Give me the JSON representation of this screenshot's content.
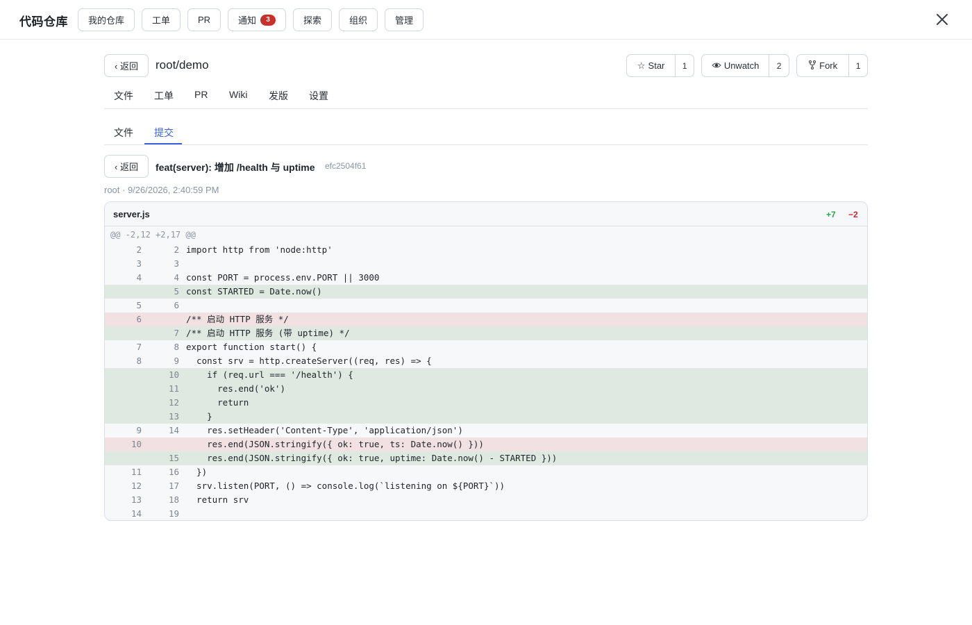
{
  "app": {
    "title": "代码仓库",
    "nav": [
      {
        "label": "我的仓库"
      },
      {
        "label": "工单"
      },
      {
        "label": "PR"
      },
      {
        "label": "通知",
        "badge": "3"
      },
      {
        "label": "探索"
      },
      {
        "label": "组织"
      },
      {
        "label": "管理"
      }
    ],
    "close_icon": "close-icon"
  },
  "repo": {
    "back_label": "‹ 返回",
    "name": "root/demo",
    "star": {
      "label": "Star",
      "icon": "star-icon",
      "count": "1"
    },
    "watch": {
      "label": "Unwatch",
      "icon": "eye-icon",
      "count": "2"
    },
    "fork": {
      "label": "Fork",
      "icon": "fork-icon",
      "count": "1"
    },
    "tabs": [
      "文件",
      "工单",
      "PR",
      "Wiki",
      "发版",
      "设置"
    ]
  },
  "subtabs": {
    "items": [
      "文件",
      "提交"
    ],
    "active": "提交"
  },
  "commit": {
    "back_label": "‹ 返回",
    "message": "feat(server): 增加 /health 与 uptime",
    "sha": "efc2504f61",
    "meta": "root · 9/26/2026, 2:40:59 PM"
  },
  "diff": {
    "file": "server.js",
    "additions": "+7",
    "deletions": "−2",
    "hunk": "@@ -2,12 +2,17 @@",
    "lines": [
      {
        "type": "ctx",
        "old": "2",
        "new": "2",
        "code": "import http from 'node:http'"
      },
      {
        "type": "ctx",
        "old": "3",
        "new": "3",
        "code": ""
      },
      {
        "type": "ctx",
        "old": "4",
        "new": "4",
        "code": "const PORT = process.env.PORT || 3000"
      },
      {
        "type": "add",
        "old": "",
        "new": "5",
        "code": "const STARTED = Date.now()"
      },
      {
        "type": "ctx",
        "old": "5",
        "new": "6",
        "code": ""
      },
      {
        "type": "del",
        "old": "6",
        "new": "",
        "code": "/** 启动 HTTP 服务 */"
      },
      {
        "type": "add",
        "old": "",
        "new": "7",
        "code": "/** 启动 HTTP 服务 (带 uptime) */"
      },
      {
        "type": "ctx",
        "old": "7",
        "new": "8",
        "code": "export function start() {"
      },
      {
        "type": "ctx",
        "old": "8",
        "new": "9",
        "code": "  const srv = http.createServer((req, res) => {"
      },
      {
        "type": "add",
        "old": "",
        "new": "10",
        "code": "    if (req.url === '/health') {"
      },
      {
        "type": "add",
        "old": "",
        "new": "11",
        "code": "      res.end('ok')"
      },
      {
        "type": "add",
        "old": "",
        "new": "12",
        "code": "      return"
      },
      {
        "type": "add",
        "old": "",
        "new": "13",
        "code": "    }"
      },
      {
        "type": "ctx",
        "old": "9",
        "new": "14",
        "code": "    res.setHeader('Content-Type', 'application/json')"
      },
      {
        "type": "del",
        "old": "10",
        "new": "",
        "code": "    res.end(JSON.stringify({ ok: true, ts: Date.now() }))"
      },
      {
        "type": "add",
        "old": "",
        "new": "15",
        "code": "    res.end(JSON.stringify({ ok: true, uptime: Date.now() - STARTED }))"
      },
      {
        "type": "ctx",
        "old": "11",
        "new": "16",
        "code": "  })"
      },
      {
        "type": "ctx",
        "old": "12",
        "new": "17",
        "code": "  srv.listen(PORT, () => console.log(`listening on ${PORT}`))"
      },
      {
        "type": "ctx",
        "old": "13",
        "new": "18",
        "code": "  return srv"
      },
      {
        "type": "ctx",
        "old": "14",
        "new": "19",
        "code": ""
      }
    ]
  },
  "colors": {
    "accent": "#3b63d6",
    "add_bg": "#dde9e1",
    "del_bg": "#f2e1e3",
    "add_text": "#2da44e",
    "del_text": "#cf222e",
    "badge": "#c9302c"
  }
}
